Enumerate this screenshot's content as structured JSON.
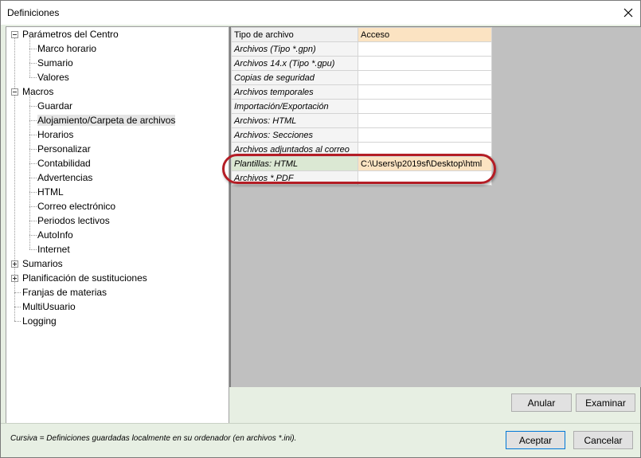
{
  "window": {
    "title": "Definiciones"
  },
  "tree": {
    "items": [
      {
        "label": "Parámetros del Centro",
        "level": 0,
        "expander": "minus"
      },
      {
        "label": "Marco horario",
        "level": 1
      },
      {
        "label": "Sumario",
        "level": 1
      },
      {
        "label": "Valores",
        "level": 1
      },
      {
        "label": "Macros",
        "level": 0,
        "expander": "minus"
      },
      {
        "label": "Guardar",
        "level": 1
      },
      {
        "label": "Alojamiento/Carpeta de archivos",
        "level": 1,
        "selected": true
      },
      {
        "label": "Horarios",
        "level": 1
      },
      {
        "label": "Personalizar",
        "level": 1
      },
      {
        "label": "Contabilidad",
        "level": 1
      },
      {
        "label": "Advertencias",
        "level": 1
      },
      {
        "label": "HTML",
        "level": 1
      },
      {
        "label": "Correo electrónico",
        "level": 1
      },
      {
        "label": "Periodos lectivos",
        "level": 1
      },
      {
        "label": "AutoInfo",
        "level": 1
      },
      {
        "label": "Internet",
        "level": 1
      },
      {
        "label": "Sumarios",
        "level": 0,
        "expander": "plus"
      },
      {
        "label": "Planificación de sustituciones",
        "level": 0,
        "expander": "plus"
      },
      {
        "label": "Franjas de materias",
        "level": 0
      },
      {
        "label": "MultiUsuario",
        "level": 0
      },
      {
        "label": "Logging",
        "level": 0
      }
    ]
  },
  "grid": {
    "headers": [
      "Tipo de archivo",
      "Acceso"
    ],
    "rows": [
      {
        "type": "Archivos (Tipo *.gpn)",
        "path": ""
      },
      {
        "type": "Archivos 14.x (Tipo *.gpu)",
        "path": ""
      },
      {
        "type": "Copias de seguridad",
        "path": ""
      },
      {
        "type": "Archivos temporales",
        "path": ""
      },
      {
        "type": "Importación/Exportación",
        "path": ""
      },
      {
        "type": "Archivos: HTML",
        "path": ""
      },
      {
        "type": "Archivos: Secciones",
        "path": ""
      },
      {
        "type": "Archivos adjuntados al correo",
        "path": ""
      },
      {
        "type": "Plantillas: HTML",
        "path": "C:\\Users\\p2019sf\\Desktop\\html",
        "selected": true
      },
      {
        "type": "Archivos *.PDF",
        "path": ""
      }
    ]
  },
  "buttons": {
    "cancel_edit": "Anular",
    "browse": "Examinar",
    "accept": "Aceptar",
    "cancel": "Cancelar"
  },
  "footer": {
    "note": "Cursiva = Definiciones guardadas localmente en su ordenador (en archivos *.ini)."
  },
  "colors": {
    "highlight_oval": "#b41d25",
    "header_accent": "#fbe3c2",
    "selected_row": "#dbe8d3"
  }
}
